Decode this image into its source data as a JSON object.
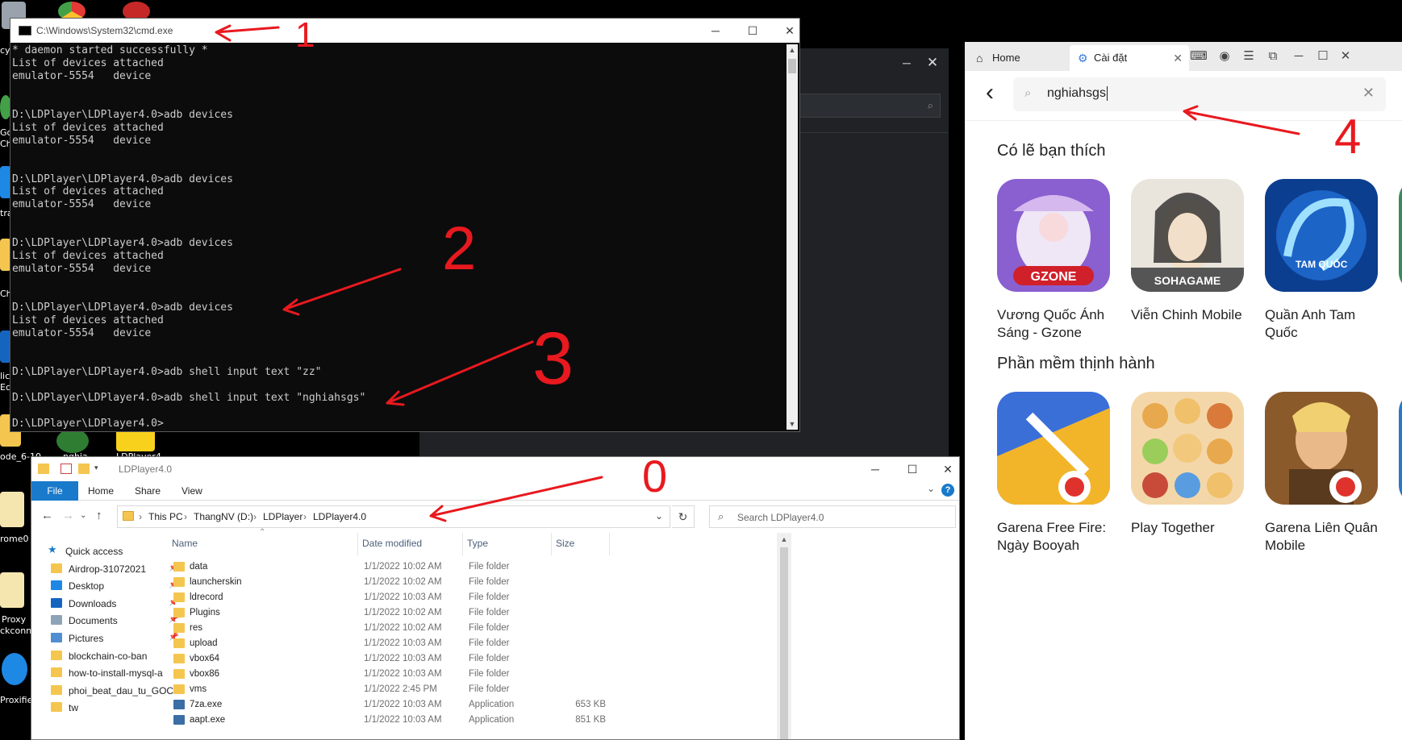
{
  "desktop": {
    "fragments": [
      "cy",
      "Go",
      "Ch",
      "tra",
      "Ch",
      "lic",
      "Ec",
      "ode_6-10",
      "nghia",
      "LDPlayer4",
      "rome0",
      "Proxy",
      "ckconn",
      "Proxifie"
    ]
  },
  "cmd": {
    "title": "C:\\Windows\\System32\\cmd.exe",
    "lines": [
      "* daemon started successfully *",
      "List of devices attached",
      "emulator-5554   device",
      "",
      "",
      "D:\\LDPlayer\\LDPlayer4.0>adb devices",
      "List of devices attached",
      "emulator-5554   device",
      "",
      "",
      "D:\\LDPlayer\\LDPlayer4.0>adb devices",
      "List of devices attached",
      "emulator-5554   device",
      "",
      "",
      "D:\\LDPlayer\\LDPlayer4.0>adb devices",
      "List of devices attached",
      "emulator-5554   device",
      "",
      "",
      "D:\\LDPlayer\\LDPlayer4.0>adb devices",
      "List of devices attached",
      "emulator-5554   device",
      "",
      "",
      "D:\\LDPlayer\\LDPlayer4.0>adb shell input text \"zz\"",
      "",
      "D:\\LDPlayer\\LDPlayer4.0>adb shell input text \"nghiahsgs\"",
      "",
      "D:\\LDPlayer\\LDPlayer4.0>"
    ]
  },
  "store": {
    "tabs": {
      "home": "Home",
      "settings": "Cài đặt"
    },
    "search_value": "nghiahsgs",
    "section1_title": "Có lẽ bạn thích",
    "section2_title": "Phần mềm thịnh hành",
    "apps_row1": [
      {
        "name": "Vương Quốc Ánh Sáng - Gzone",
        "badge": "GZONE"
      },
      {
        "name": "Viễn Chinh Mobile",
        "badge": "SOHAGAME"
      },
      {
        "name": "Quần Anh Tam Quốc",
        "badge": "TAM QUỐC"
      }
    ],
    "apps_row2": [
      {
        "name": "Garena Free Fire: Ngày Booyah"
      },
      {
        "name": "Play Together"
      },
      {
        "name": "Garena Liên Quân Mobile"
      }
    ]
  },
  "explorer": {
    "title": "LDPlayer4.0",
    "ribbon_tabs": [
      "File",
      "Home",
      "Share",
      "View"
    ],
    "breadcrumb": [
      "This PC",
      "ThangNV (D:)",
      "LDPlayer",
      "LDPlayer4.0"
    ],
    "search_placeholder": "Search LDPlayer4.0",
    "nav_items": [
      {
        "label": "Quick access",
        "icon": "star-icon",
        "pinned": false
      },
      {
        "label": "Airdrop-31072021",
        "icon": "folder-icon",
        "pinned": true
      },
      {
        "label": "Desktop",
        "icon": "desktop-icon",
        "pinned": true
      },
      {
        "label": "Downloads",
        "icon": "download-icon",
        "pinned": true
      },
      {
        "label": "Documents",
        "icon": "document-icon",
        "pinned": true
      },
      {
        "label": "Pictures",
        "icon": "pictures-icon",
        "pinned": true
      },
      {
        "label": "blockchain-co-ban",
        "icon": "folder-icon",
        "pinned": false
      },
      {
        "label": "how-to-install-mysql-a",
        "icon": "folder-icon",
        "pinned": false
      },
      {
        "label": "phoi_beat_dau_tu_GOC",
        "icon": "folder-icon",
        "pinned": false
      },
      {
        "label": "tw",
        "icon": "folder-icon",
        "pinned": false
      }
    ],
    "columns": [
      "Name",
      "Date modified",
      "Type",
      "Size"
    ],
    "files": [
      {
        "name": "data",
        "date": "1/1/2022 10:02 AM",
        "type": "File folder",
        "size": "",
        "icon": "folder-icon"
      },
      {
        "name": "launcherskin",
        "date": "1/1/2022 10:02 AM",
        "type": "File folder",
        "size": "",
        "icon": "folder-icon"
      },
      {
        "name": "ldrecord",
        "date": "1/1/2022 10:03 AM",
        "type": "File folder",
        "size": "",
        "icon": "folder-icon"
      },
      {
        "name": "Plugins",
        "date": "1/1/2022 10:02 AM",
        "type": "File folder",
        "size": "",
        "icon": "folder-icon"
      },
      {
        "name": "res",
        "date": "1/1/2022 10:02 AM",
        "type": "File folder",
        "size": "",
        "icon": "folder-icon"
      },
      {
        "name": "upload",
        "date": "1/1/2022 10:03 AM",
        "type": "File folder",
        "size": "",
        "icon": "folder-icon"
      },
      {
        "name": "vbox64",
        "date": "1/1/2022 10:03 AM",
        "type": "File folder",
        "size": "",
        "icon": "folder-icon"
      },
      {
        "name": "vbox86",
        "date": "1/1/2022 10:03 AM",
        "type": "File folder",
        "size": "",
        "icon": "folder-icon"
      },
      {
        "name": "vms",
        "date": "1/1/2022 2:45 PM",
        "type": "File folder",
        "size": "",
        "icon": "folder-icon"
      },
      {
        "name": "7za.exe",
        "date": "1/1/2022 10:03 AM",
        "type": "Application",
        "size": "653 KB",
        "icon": "app-icon"
      },
      {
        "name": "aapt.exe",
        "date": "1/1/2022 10:03 AM",
        "type": "Application",
        "size": "851 KB",
        "icon": "app-icon"
      }
    ]
  },
  "annotations": {
    "labels": [
      "1",
      "2",
      "3",
      "4",
      "0"
    ]
  },
  "colors": {
    "annotation": "#e8191f",
    "folder": "#f5c64f",
    "accent": "#1979ca"
  }
}
